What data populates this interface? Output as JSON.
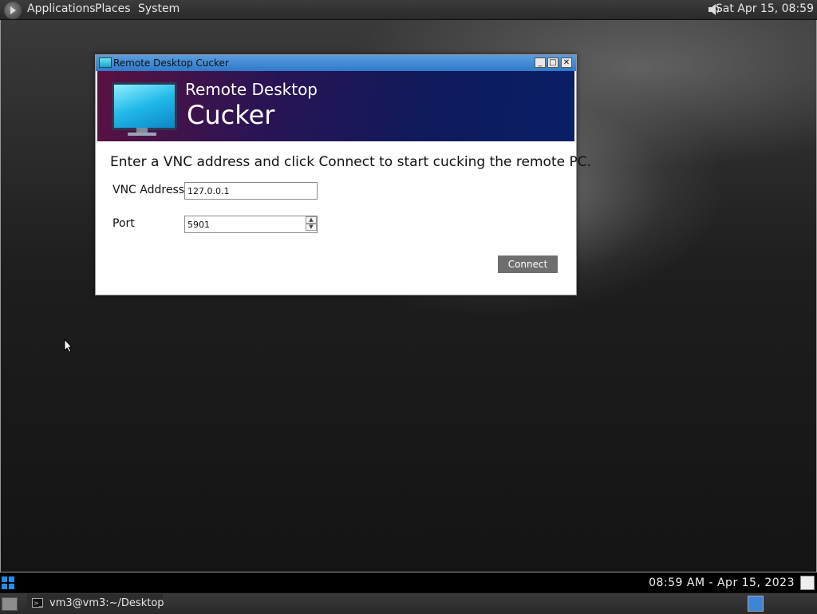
{
  "top_panel": {
    "menus": [
      "Applications",
      "Places",
      "System"
    ],
    "clock": "Sat Apr 15, 08:59",
    "icons": {
      "logo": "distro-logo-icon",
      "volume": "speaker-icon"
    }
  },
  "window": {
    "title": "Remote Desktop Cucker",
    "controls": {
      "minimize": "_",
      "maximize": "□",
      "close": "✕"
    },
    "banner": {
      "line1": "Remote Desktop",
      "line2": "Cucker",
      "icon": "monitor-icon"
    },
    "instruction": "Enter a VNC address and click Connect to start cucking the remote PC.",
    "form": {
      "vnc_label": "VNC Address",
      "vnc_value": "127.0.0.1",
      "port_label": "Port",
      "port_value": "5901"
    },
    "connect_label": "Connect"
  },
  "taskbar": {
    "clock": "08:59 AM - Apr 15, 2023",
    "icons": {
      "start": "windows-start-icon",
      "user": "user-icon"
    }
  },
  "bottom_panel": {
    "task_label": "vm3@vm3:~/Desktop",
    "icons": {
      "show_desktop": "show-desktop-icon",
      "terminal": "terminal-icon",
      "workspace": "workspace-switcher-icon"
    }
  },
  "colors": {
    "titlebar": "#2f79c9",
    "banner_start": "#5a1240",
    "banner_end": "#0a1f66",
    "connect_button": "#6e6e6e",
    "start_icon": "#1e8ee8"
  }
}
